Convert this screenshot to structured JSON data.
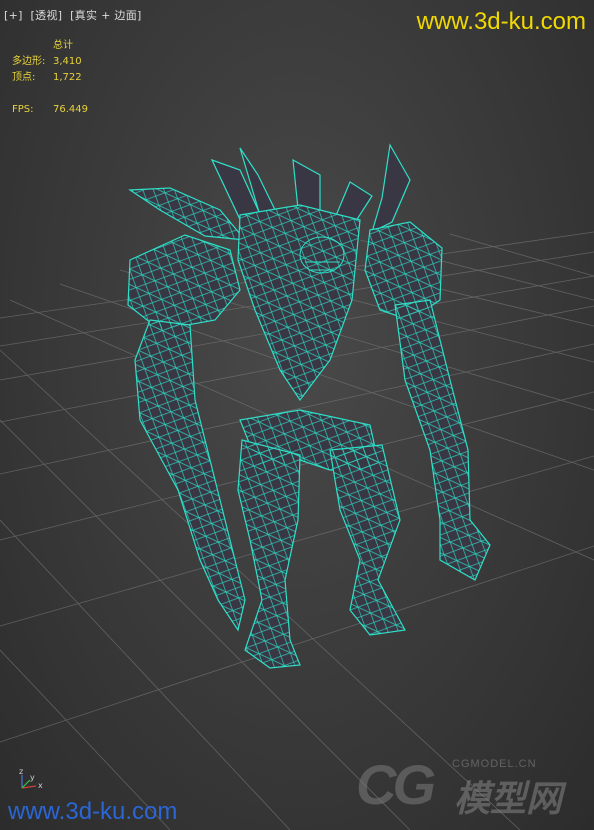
{
  "viewport": {
    "label_parts": [
      "[+]",
      "[透视]",
      "[真实 + 边面]"
    ]
  },
  "stats": {
    "title": "总计",
    "polys_label": "多边形:",
    "polys_value": "3,410",
    "verts_label": "顶点:",
    "verts_value": "1,722",
    "fps_label": "FPS:",
    "fps_value": "76.449"
  },
  "watermarks": {
    "top": "www.3d-ku.com",
    "bottom": "www.3d-ku.com",
    "cg_letters": "CG",
    "cg_site": "CGMODEL.CN",
    "cg_chinese": "模型网"
  },
  "axis_gizmo": {
    "x_label": "x",
    "y_label": "y",
    "z_label": "z"
  },
  "colors": {
    "wireframe": "#2ee0c8",
    "mesh_fill": "#3a3744",
    "stats_text": "#e8d23a",
    "watermark_top": "#f1d800",
    "watermark_bottom": "#2a66d6",
    "grid": "#6e6e6e"
  }
}
